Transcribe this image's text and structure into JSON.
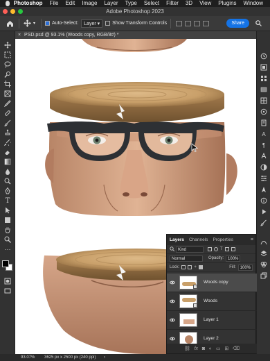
{
  "menubar": {
    "items": [
      "Photoshop",
      "File",
      "Edit",
      "Image",
      "Layer",
      "Type",
      "Select",
      "Filter",
      "3D",
      "View",
      "Plugins",
      "Window"
    ]
  },
  "window": {
    "title": "Adobe Photoshop 2023"
  },
  "options": {
    "auto_select_label": "Auto-Select:",
    "auto_select_value": "Layer",
    "transform_label": "Show Transform Controls",
    "share_label": "Share"
  },
  "document": {
    "tab": "PSD.psd @ 93.1% (Woods copy, RGB/8#) *"
  },
  "status": {
    "zoom": "93.07%",
    "info": "3625 px x 2500 px (240 ppi)"
  },
  "layers_panel": {
    "tabs": [
      "Layers",
      "Channels",
      "Properties"
    ],
    "filter_label": "Kind",
    "blend_mode": "Normal",
    "opacity_label": "Opacity:",
    "opacity_value": "100%",
    "lock_label": "Lock:",
    "fill_label": "Fill:",
    "fill_value": "100%",
    "layers": [
      {
        "name": "Woods copy",
        "selected": true
      },
      {
        "name": "Woods",
        "selected": false
      },
      {
        "name": "Layer 1",
        "selected": false
      },
      {
        "name": "Layer 2",
        "selected": false
      }
    ],
    "footer_link": "fx"
  },
  "colors": {
    "accent": "#1473e6",
    "panel": "#333333",
    "ui_dark": "#2b2b2b"
  }
}
